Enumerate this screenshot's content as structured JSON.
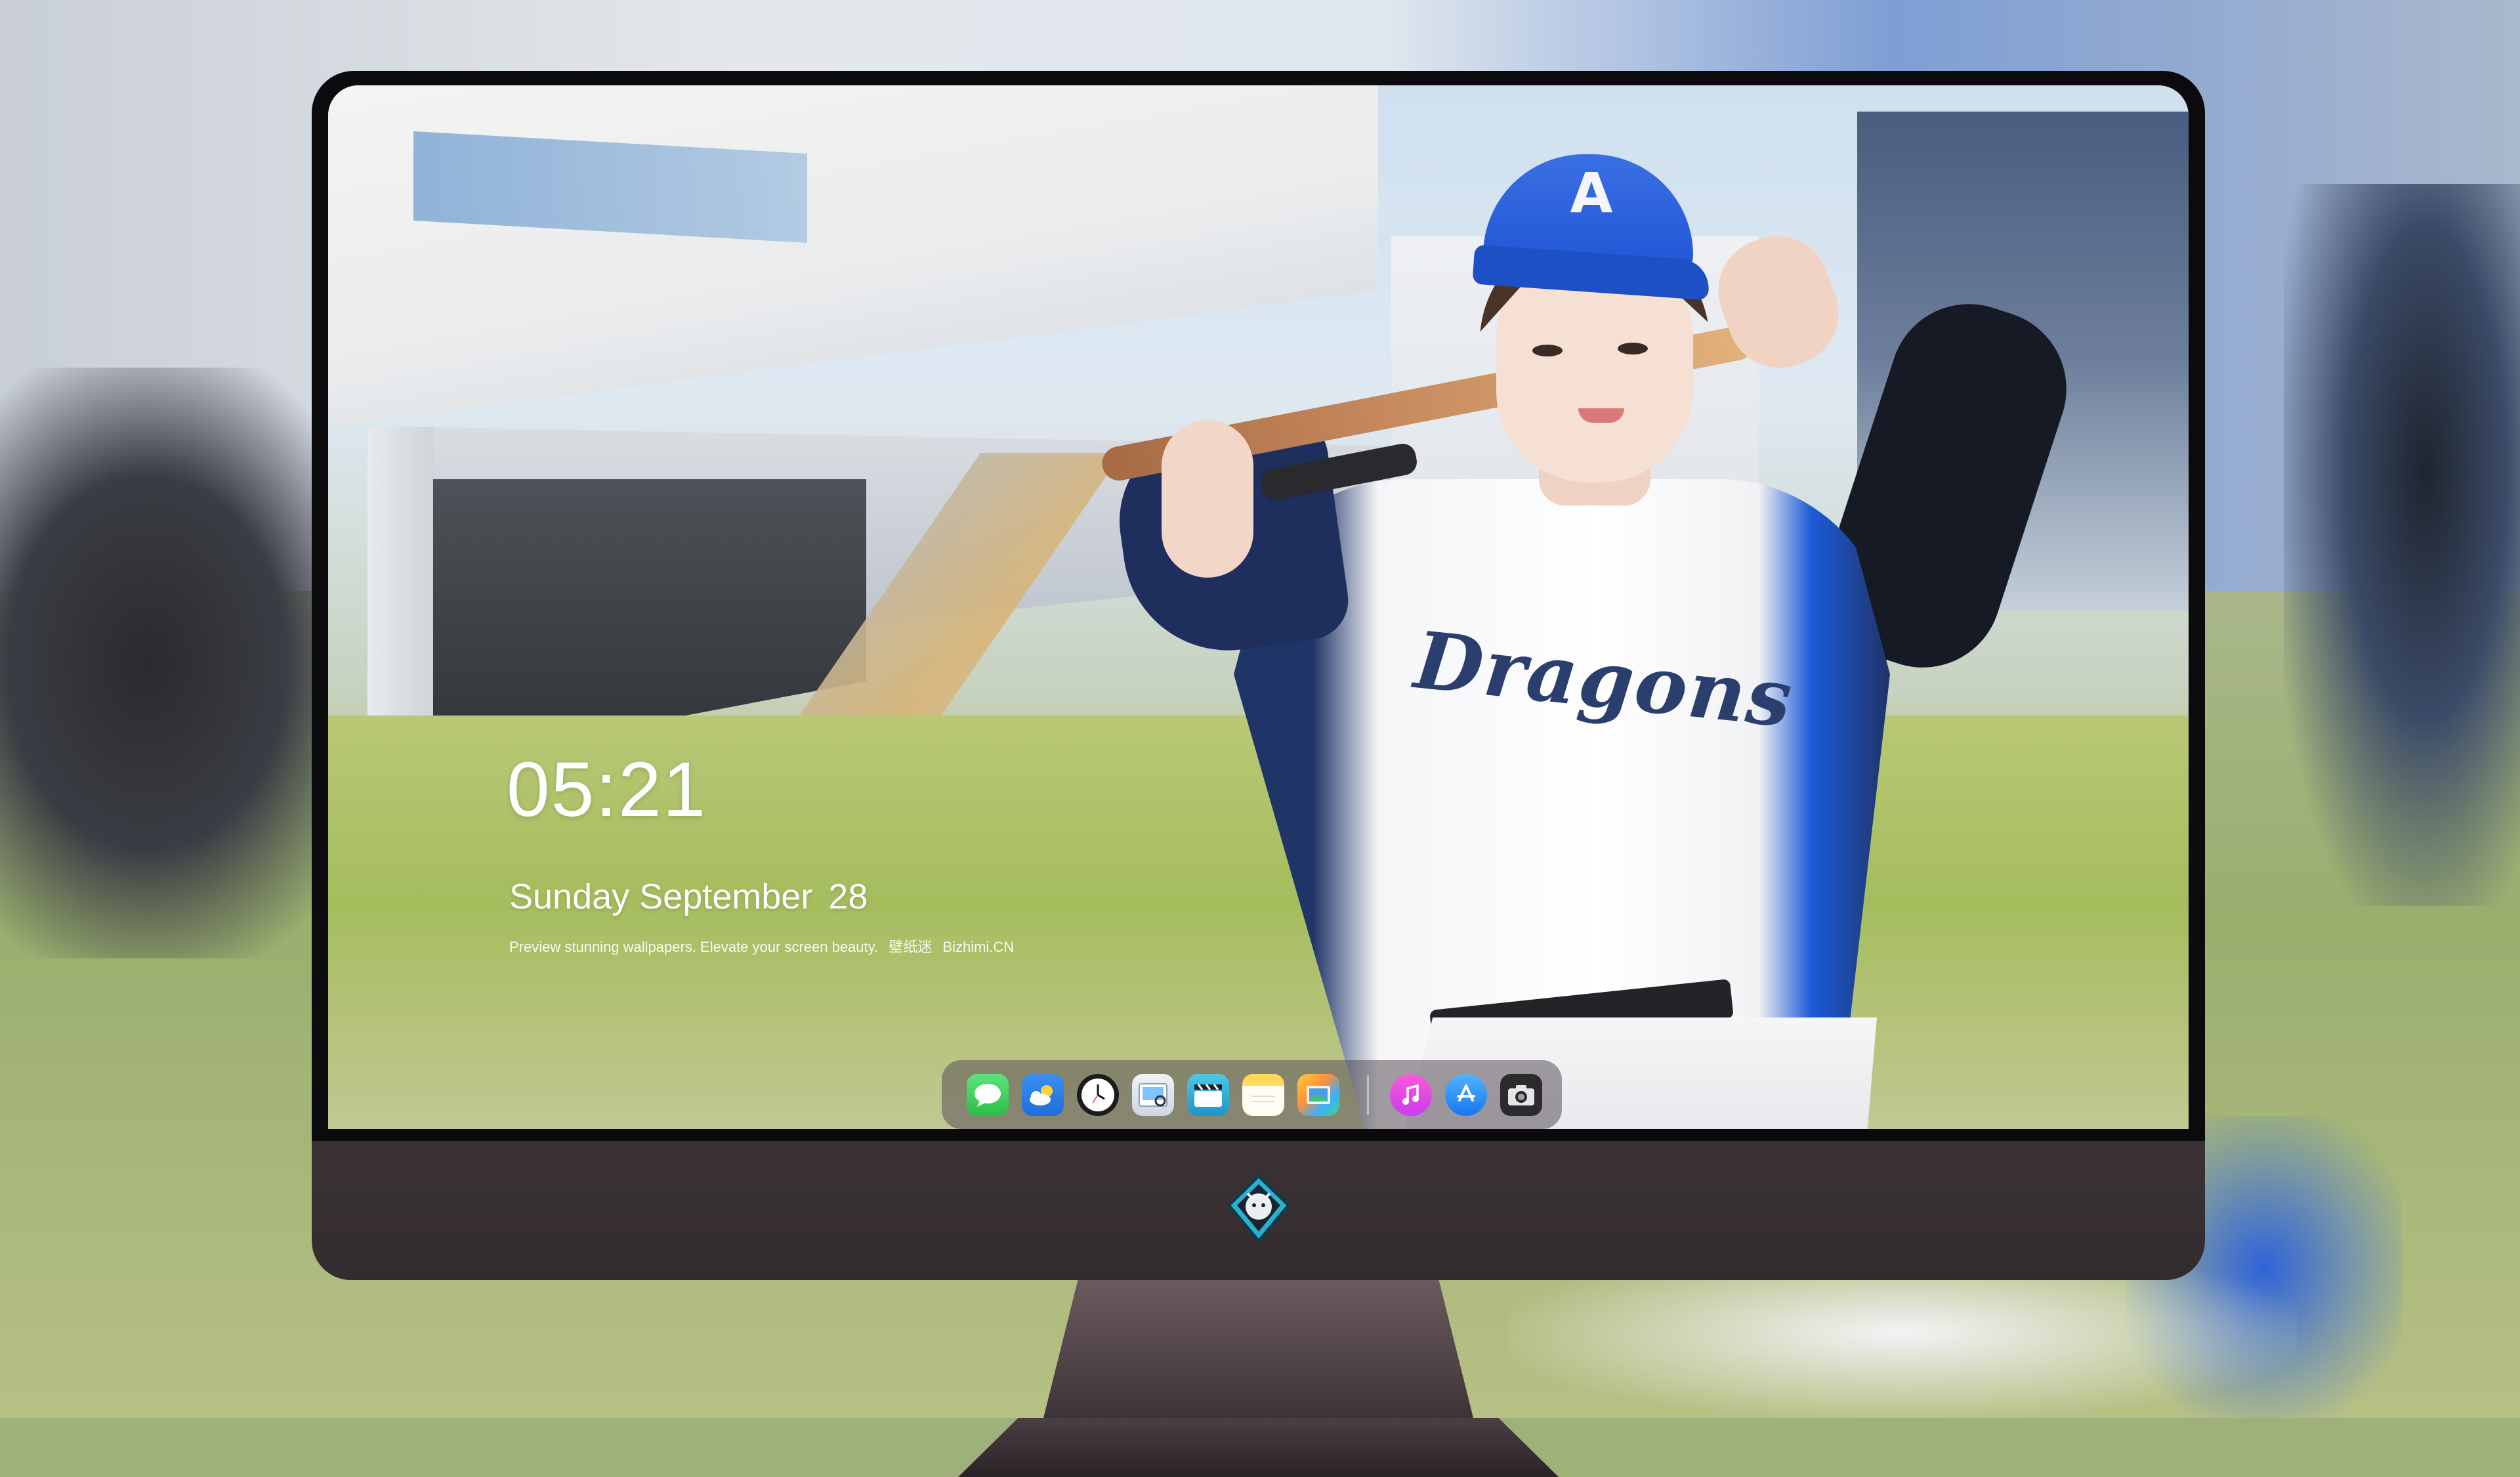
{
  "lock_screen": {
    "time": "05:21",
    "weekday_month": "Sunday September",
    "day": "28",
    "tagline": "Preview stunning wallpapers. Elevate your screen beauty.",
    "brand_cn": "壁纸迷",
    "brand_site": "Bizhimi.CN"
  },
  "wallpaper": {
    "cap_letter": "A",
    "jersey_text": "Dragons"
  },
  "dock": {
    "apps": [
      {
        "name": "Messages",
        "icon": "messages-icon"
      },
      {
        "name": "Weather",
        "icon": "weather-icon"
      },
      {
        "name": "Clock",
        "icon": "clock-icon"
      },
      {
        "name": "Preview",
        "icon": "preview-icon"
      },
      {
        "name": "Claquette",
        "icon": "clapperboard-icon"
      },
      {
        "name": "Notes",
        "icon": "notes-icon"
      },
      {
        "name": "Photo Slideshow",
        "icon": "photos-icon"
      },
      {
        "name": "Music",
        "icon": "music-icon"
      },
      {
        "name": "App Store",
        "icon": "app-store-icon"
      },
      {
        "name": "Screenshot",
        "icon": "camera-icon"
      }
    ]
  },
  "monitor": {
    "chin_logo": "dragon-emblem-icon"
  },
  "colors": {
    "bezel": "#0b0b0d",
    "chin": "#352d30",
    "cap_blue": "#2a62dc",
    "jersey_navy": "#1f3467"
  }
}
